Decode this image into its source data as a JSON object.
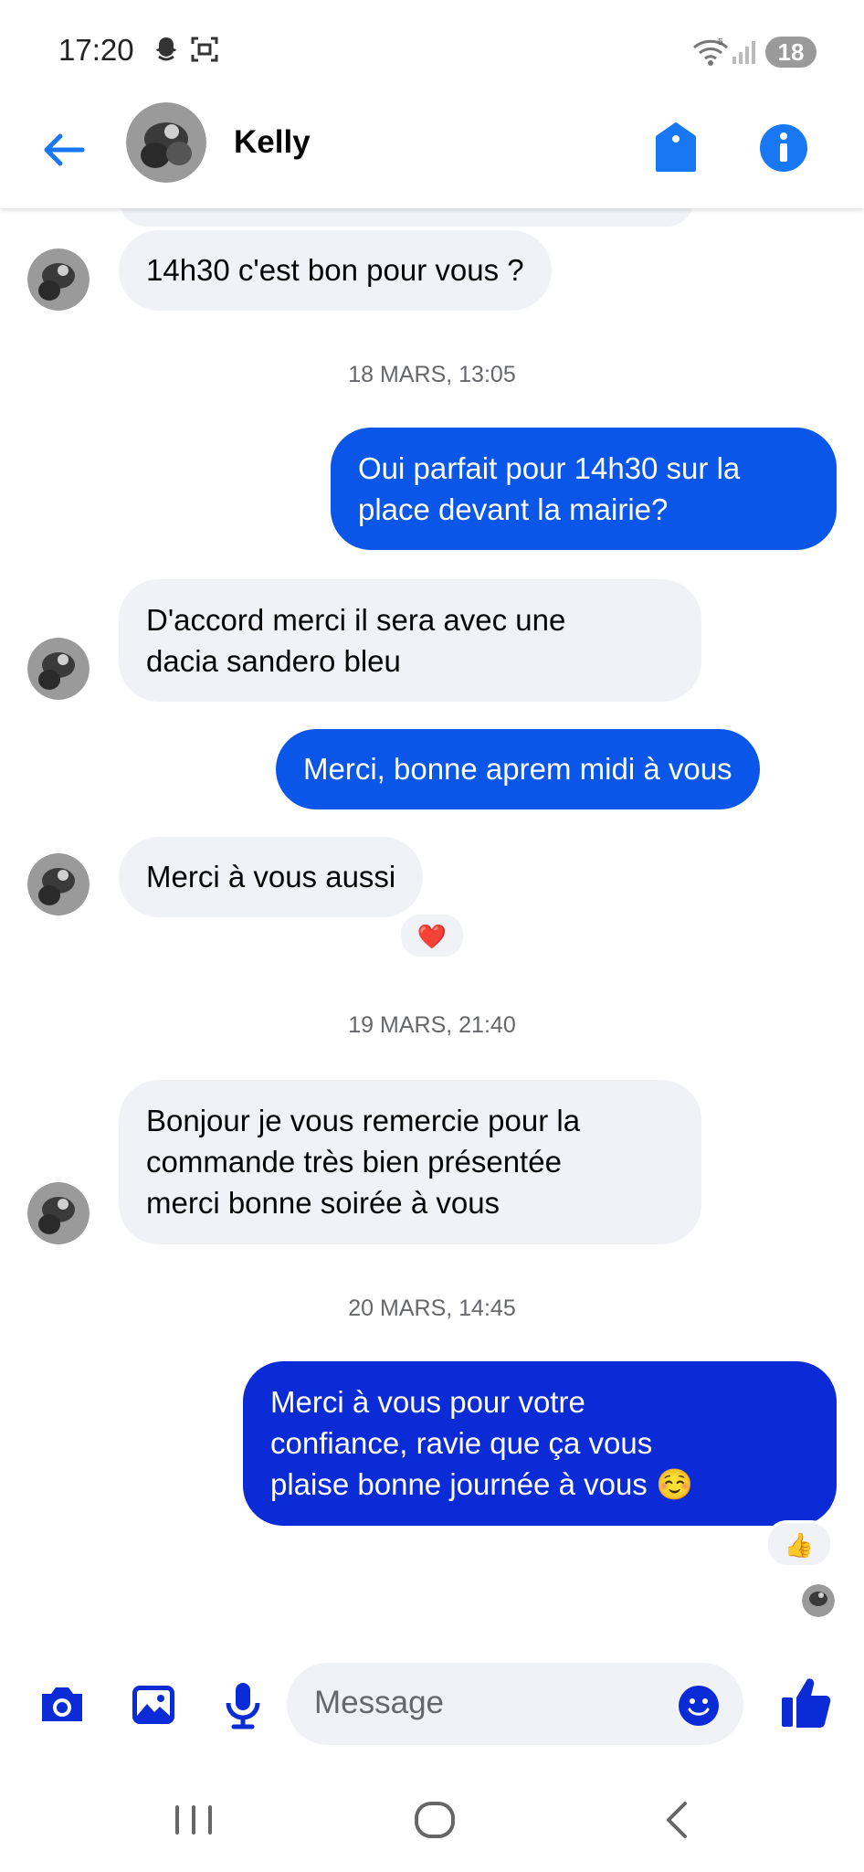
{
  "status_bar": {
    "time": "17:20",
    "battery": "18"
  },
  "header": {
    "contact_name": "Kelly"
  },
  "colors": {
    "accent": "#0a56e8",
    "accent_dark": "#0a2bd6",
    "incoming_bubble": "#f0f2f5",
    "header_icon": "#1877f2",
    "composer_icon": "#0a2bd6"
  },
  "messages": [
    {
      "direction": "in",
      "text": "14h30 c'est bon pour vous ?"
    },
    {
      "timestamp": "18 MARS, 13:05"
    },
    {
      "direction": "out",
      "lines": [
        "Oui parfait pour 14h30 sur la",
        "place devant la mairie?"
      ]
    },
    {
      "direction": "in",
      "lines": [
        "D'accord merci il sera avec une",
        "dacia sandero bleu"
      ]
    },
    {
      "direction": "out",
      "text": "Merci, bonne aprem midi à vous"
    },
    {
      "direction": "in",
      "text": "Merci à vous aussi",
      "reaction": "❤️"
    },
    {
      "timestamp": "19 MARS, 21:40"
    },
    {
      "direction": "in",
      "lines": [
        "Bonjour je vous remercie pour la",
        "commande très bien présentée",
        "merci bonne soirée à vous"
      ]
    },
    {
      "timestamp": "20 MARS, 14:45"
    },
    {
      "direction": "out",
      "lines": [
        "Merci à vous pour votre",
        "confiance, ravie que ça vous",
        "plaise bonne journée à vous ☺️"
      ],
      "reaction": "👍"
    }
  ],
  "composer": {
    "placeholder": "Message"
  },
  "icons": {
    "status": [
      "snapchat-icon",
      "screenshot-icon",
      "wifi-icon",
      "signal-icon"
    ],
    "header": [
      "back-arrow-icon",
      "tag-icon",
      "info-icon"
    ],
    "composer": [
      "camera-icon",
      "image-icon",
      "microphone-icon",
      "emoji-icon",
      "thumbs-up-icon"
    ],
    "nav": [
      "recent-apps-icon",
      "home-icon",
      "back-icon"
    ]
  }
}
